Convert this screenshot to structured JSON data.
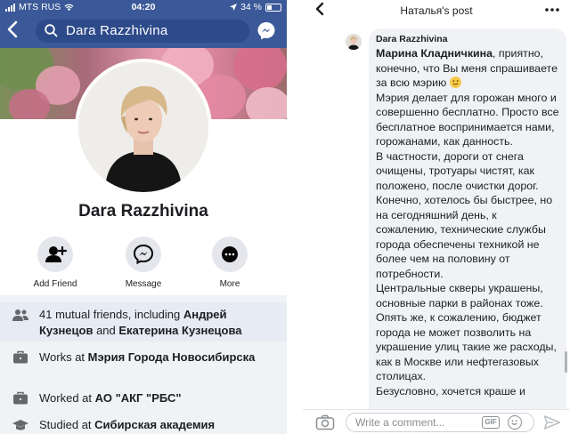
{
  "status_bar": {
    "carrier": "MTS RUS",
    "time": "04:20",
    "battery": "34 %"
  },
  "search": {
    "value": "Dara  Razzhivina"
  },
  "profile": {
    "name": "Dara  Razzhivina",
    "actions": [
      {
        "label": "Add Friend",
        "icon": "add-friend-icon"
      },
      {
        "label": "Message",
        "icon": "messenger-icon"
      },
      {
        "label": "More",
        "icon": "more-dots-icon"
      }
    ],
    "info": [
      {
        "icon": "mutual-friends-icon",
        "prefix": "41 mutual friends, including ",
        "name1": "Андрей Кузнецов",
        "mid": " and ",
        "name2": "Екатерина Кузнецова"
      },
      {
        "icon": "briefcase-icon",
        "prefix": "Works at ",
        "bold": "Мэрия Города Новосибирска"
      },
      {
        "icon": "briefcase-icon",
        "prefix": "Worked at ",
        "bold": "АО \"АКГ \"РБС\""
      },
      {
        "icon": "graduation-cap-icon",
        "prefix": "Studied at ",
        "bold": "Сибирская академия"
      }
    ]
  },
  "post_view": {
    "title": "Наталья's post",
    "comment": {
      "author": "Dara  Razzhivina",
      "mention": "Марина Кладничкина",
      "text_part1": ", приятно, конечно, что Вы меня спрашиваете за всю мэрию ",
      "text_part2": "Мэрия делает для горожан много и совершенно бесплатно. Просто все бесплатное воспринимается нами, горожанами, как данность.",
      "text_part3": "В частности, дороги от снега очищены, тротуары чистят, как положено, после очистки дорог. Конечно, хотелось бы быстрее, но на сегодняшний день, к сожалению, технические службы города обеспечены техникой не более чем на половину от потребности.",
      "text_part4": "Центральные скверы украшены, основные парки в районах тоже. Опять же, к сожалению, бюджет города не может позволить на украшение улиц такие же расходы, как в Москве или нефтегазовых столицах.",
      "text_part5": "Безусловно, хочется краше и"
    },
    "composer": {
      "placeholder": "Write a comment...",
      "gif_label": "GIF"
    }
  },
  "colors": {
    "fb_blue": "#3b5998",
    "highlight_row": "#e7ebf4",
    "bubble": "#f0f2f5"
  }
}
